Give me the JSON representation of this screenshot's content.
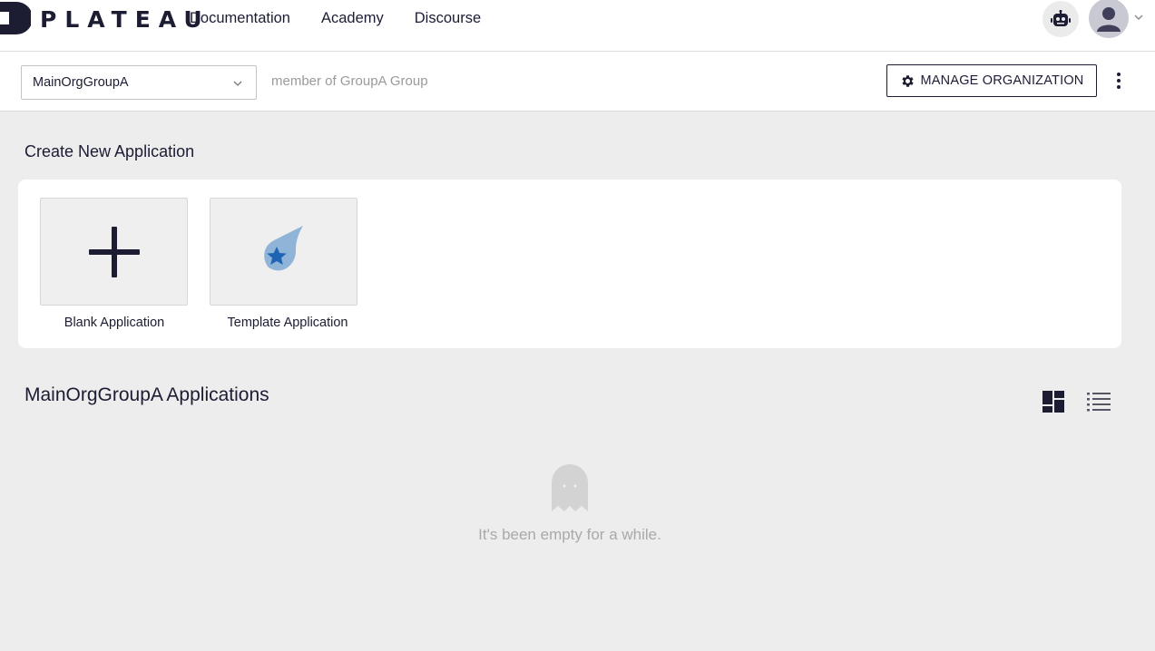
{
  "brand": {
    "name": "PLATEAU"
  },
  "nav": {
    "links": [
      "Documentation",
      "Academy",
      "Discourse"
    ]
  },
  "org": {
    "selected": "MainOrgGroupA",
    "member_text": "member of GroupA Group",
    "manage_label": "MANAGE ORGANIZATION"
  },
  "create": {
    "title": "Create New Application",
    "blank_label": "Blank Application",
    "template_label": "Template Application"
  },
  "apps": {
    "title": "MainOrgGroupA Applications",
    "empty_text": "It's been empty for a while."
  },
  "colors": {
    "primary": "#1c1c33",
    "template_icon_light": "#8fb4d8",
    "template_icon_dark": "#1f64b3",
    "background": "#ededed"
  },
  "icons": {
    "bot": "robot-icon",
    "avatar": "user-avatar-icon",
    "manage": "gear-icon",
    "grid_view": "grid-view-icon",
    "list_view": "list-view-icon",
    "empty": "ghost-icon"
  }
}
